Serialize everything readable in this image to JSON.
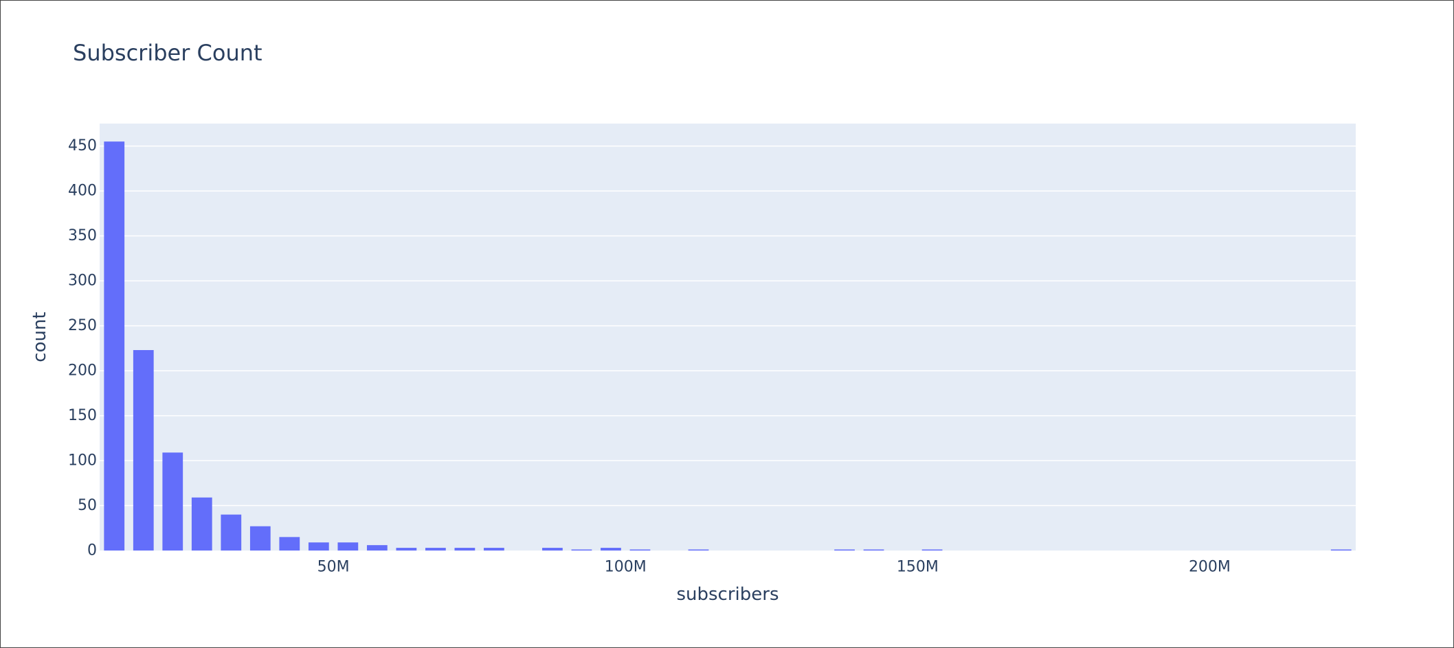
{
  "chart_data": {
    "type": "bar",
    "title": "Subscriber Count",
    "xlabel": "subscribers",
    "ylabel": "count",
    "bin_width": 5000000,
    "x_bin_starts": [
      10000000,
      15000000,
      20000000,
      25000000,
      30000000,
      35000000,
      40000000,
      45000000,
      50000000,
      55000000,
      60000000,
      65000000,
      70000000,
      75000000,
      80000000,
      85000000,
      90000000,
      95000000,
      100000000,
      105000000,
      110000000,
      115000000,
      120000000,
      125000000,
      130000000,
      135000000,
      140000000,
      145000000,
      150000000,
      155000000,
      160000000,
      165000000,
      170000000,
      175000000,
      180000000,
      185000000,
      190000000,
      195000000,
      200000000,
      205000000,
      210000000,
      215000000,
      220000000
    ],
    "values": [
      455,
      223,
      109,
      59,
      40,
      27,
      15,
      9,
      9,
      6,
      3,
      3,
      3,
      3,
      0,
      3,
      1,
      3,
      1,
      0,
      1,
      0,
      0,
      0,
      0,
      1,
      1,
      0,
      1,
      0,
      0,
      0,
      0,
      0,
      0,
      0,
      0,
      0,
      0,
      0,
      0,
      0,
      1
    ],
    "xlim": [
      10000000,
      225000000
    ],
    "ylim": [
      0,
      475
    ],
    "x_ticks": [
      50000000,
      100000000,
      150000000,
      200000000
    ],
    "x_tick_labels": [
      "50M",
      "100M",
      "150M",
      "200M"
    ],
    "y_ticks": [
      0,
      50,
      100,
      150,
      200,
      250,
      300,
      350,
      400,
      450
    ],
    "y_tick_labels": [
      "0",
      "50",
      "100",
      "150",
      "200",
      "250",
      "300",
      "350",
      "400",
      "450"
    ],
    "grid": true,
    "legend": "none"
  },
  "colors": {
    "bar": "#636efa",
    "plot_bg": "#e5ecf6",
    "grid": "#ffffff",
    "text": "#2a3f5f"
  }
}
